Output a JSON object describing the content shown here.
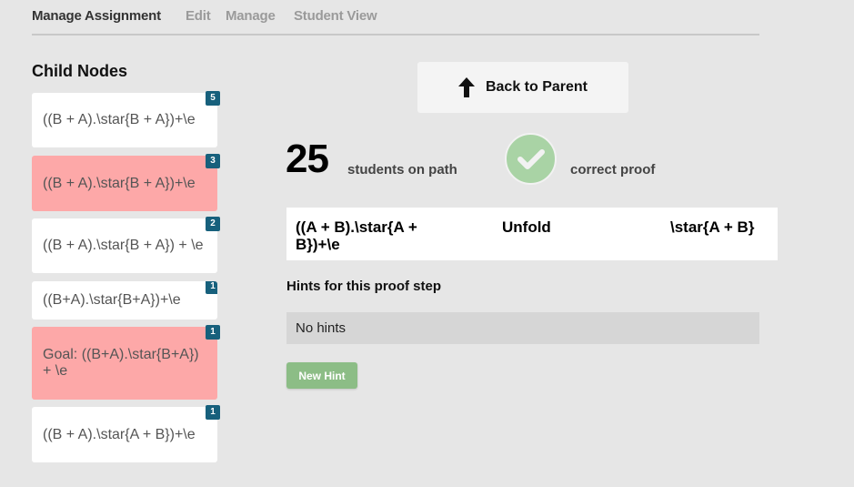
{
  "nav": {
    "active": "Manage Assignment",
    "links": [
      "Edit",
      "Manage",
      "Student View"
    ]
  },
  "sidebar": {
    "title": "Child Nodes",
    "nodes": [
      {
        "text": "((B + A).\\star{B + A})+\\e",
        "count": "5",
        "highlight": false
      },
      {
        "text": "((B + A).\\star{B + A})+\\e",
        "count": "3",
        "highlight": true
      },
      {
        "text": "((B + A).\\star{B + A}) + \\e",
        "count": "2",
        "highlight": false
      },
      {
        "text": "((B+A).\\star{B+A})+\\e",
        "count": "1",
        "highlight": false
      },
      {
        "text": "Goal: ((B+A).\\star{B+A}) + \\e",
        "count": "1",
        "highlight": true
      },
      {
        "text": "((B + A).\\star{A + B})+\\e",
        "count": "1",
        "highlight": false
      }
    ]
  },
  "main": {
    "back_label": "Back to Parent",
    "students_count": "25",
    "students_label": "students on path",
    "status_label": "correct proof",
    "proof_step": {
      "expression": "((A + B).\\star{A + B})+\\e",
      "rule": "Unfold",
      "result": "\\star{A + B}"
    },
    "hints_title": "Hints for this proof step",
    "hints_empty": "No hints",
    "new_hint_label": "New Hint"
  },
  "colors": {
    "background": "#e6e6e6",
    "highlight_node": "#fda8a8",
    "badge": "#17607c",
    "success": "#8cbd86"
  }
}
